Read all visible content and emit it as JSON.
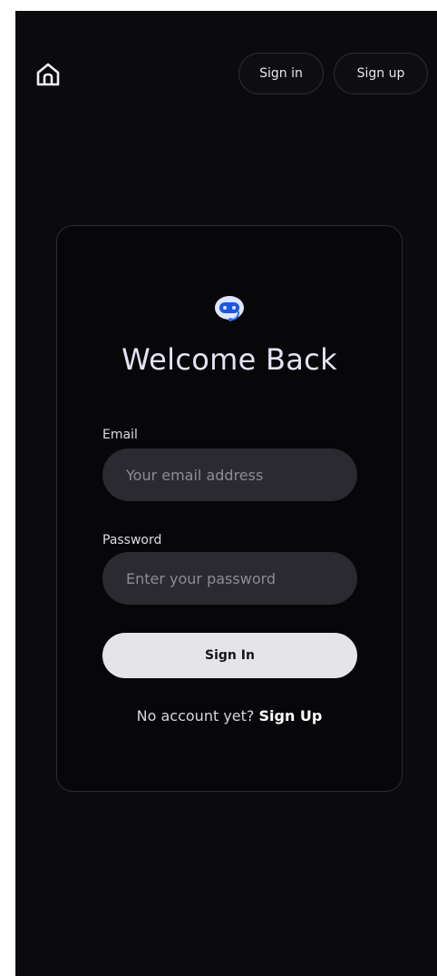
{
  "nav": {
    "home_icon": "home-icon",
    "sign_in_label": "Sign in",
    "sign_up_label": "Sign up"
  },
  "card": {
    "logo_icon": "robot-headset-icon",
    "title": "Welcome Back",
    "email": {
      "label": "Email",
      "value": "",
      "placeholder": "Your email address"
    },
    "password": {
      "label": "Password",
      "value": "",
      "placeholder": "Enter your password"
    },
    "submit_label": "Sign In",
    "footer_prompt": "No account yet?",
    "footer_link": "Sign Up"
  },
  "colors": {
    "background": "#0b0b0e",
    "card_background": "#07070a",
    "input_background": "#2a2a30",
    "button_background": "#e5e5e8",
    "logo_accent": "#2f6bff",
    "title_color": "#e3e3f4"
  }
}
